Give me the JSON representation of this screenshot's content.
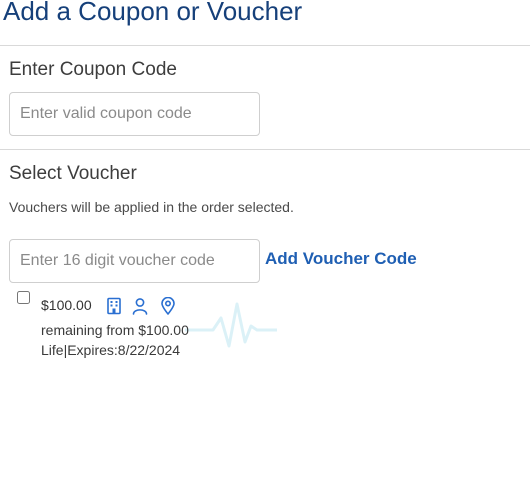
{
  "page": {
    "title": "Add a Coupon or Voucher"
  },
  "coupon": {
    "heading": "Enter Coupon Code",
    "input_placeholder": "Enter valid coupon code",
    "input_value": ""
  },
  "voucher": {
    "heading": "Select Voucher",
    "note": "Vouchers will be applied in the order selected.",
    "input_placeholder": "Enter 16 digit voucher code",
    "input_value": "",
    "add_label": "Add Voucher Code",
    "accent_color": "#1f5fb3",
    "items": [
      {
        "checked": false,
        "amount": "$100.00",
        "remaining": "remaining from $100.00",
        "term": "Life|Expires:8/22/2024",
        "icons": [
          "building-icon",
          "person-icon",
          "location-pin-icon"
        ]
      }
    ]
  },
  "colors": {
    "title": "#16407a",
    "link": "#1f5fb3",
    "icon": "#2a6fd1",
    "watermark": "#bfe6f2"
  }
}
